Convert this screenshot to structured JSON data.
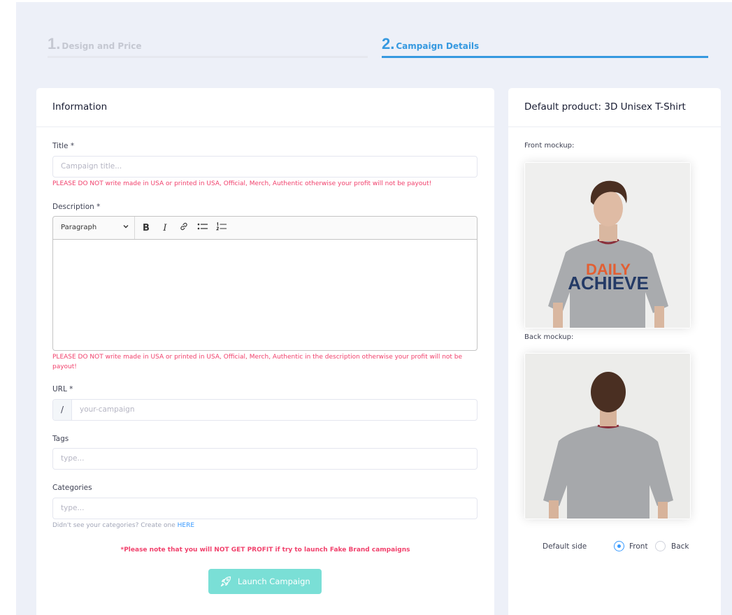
{
  "steps": [
    {
      "number": "1.",
      "label": "Design and Price"
    },
    {
      "number": "2.",
      "label": "Campaign Details"
    }
  ],
  "info": {
    "heading": "Information",
    "title_label": "Title *",
    "title_placeholder": "Campaign title...",
    "title_warning": "PLEASE DO NOT write made in USA or printed in USA, Official, Merch, Authentic otherwise your profit will not be payout!",
    "description_label": "Description *",
    "editor": {
      "paragraph": "Paragraph",
      "bold": "B",
      "italic": "I"
    },
    "description_warning": "PLEASE DO NOT write made in USA or printed in USA, Official, Merch, Authentic in the description otherwise your profit will not be payout!",
    "url_label": "URL *",
    "url_prefix": "/",
    "url_placeholder": "your-campaign",
    "tags_label": "Tags",
    "tags_placeholder": "type...",
    "categories_label": "Categories",
    "categories_placeholder": "type...",
    "categories_hint": "Didn't see your categories? Create one",
    "categories_hint_link": "HERE",
    "notice": "*Please note that you will NOT GET PROFIT if try to launch Fake Brand campaigns",
    "launch_label": "Launch Campaign"
  },
  "product": {
    "heading": "Default product: 3D Unisex T-Shirt",
    "front_label": "Front mockup:",
    "back_label": "Back mockup:",
    "shirt_print_top": "DAILY",
    "shirt_print_bottom": "ACHIEVE",
    "default_side_label": "Default side",
    "options": [
      {
        "label": "Front",
        "selected": true
      },
      {
        "label": "Back",
        "selected": false
      }
    ]
  },
  "colors": {
    "accent": "#3699e0",
    "danger": "#f1416c",
    "launch": "#7adfd6"
  }
}
